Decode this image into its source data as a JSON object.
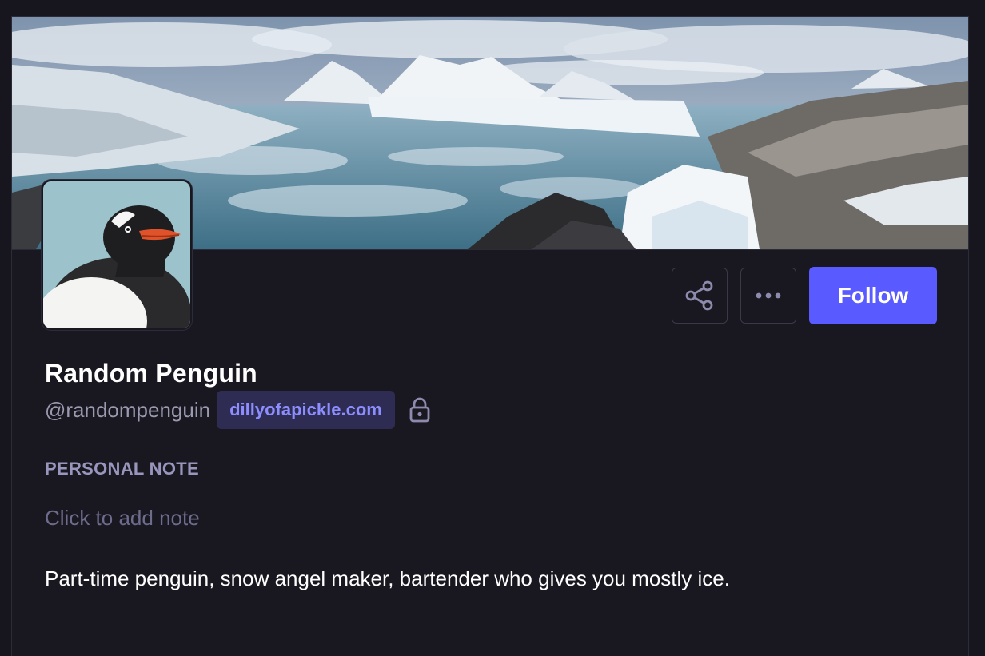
{
  "profile": {
    "display_name": "Random Penguin",
    "handle": "@randompenguin",
    "domain": "dillyofapickle.com",
    "bio": "Part-time penguin, snow angel maker, bartender who gives you mostly ice."
  },
  "note": {
    "label": "PERSONAL NOTE",
    "placeholder": "Click to add note"
  },
  "actions": {
    "share_icon": "share-icon",
    "more_icon": "more-icon",
    "follow_label": "Follow"
  },
  "icons": {
    "lock": "lock-icon"
  },
  "colors": {
    "accent": "#595aff",
    "background": "#191820",
    "domain_badge_bg": "#2e2c52",
    "domain_badge_text": "#8c8dff",
    "muted_text": "#9b99b0"
  }
}
